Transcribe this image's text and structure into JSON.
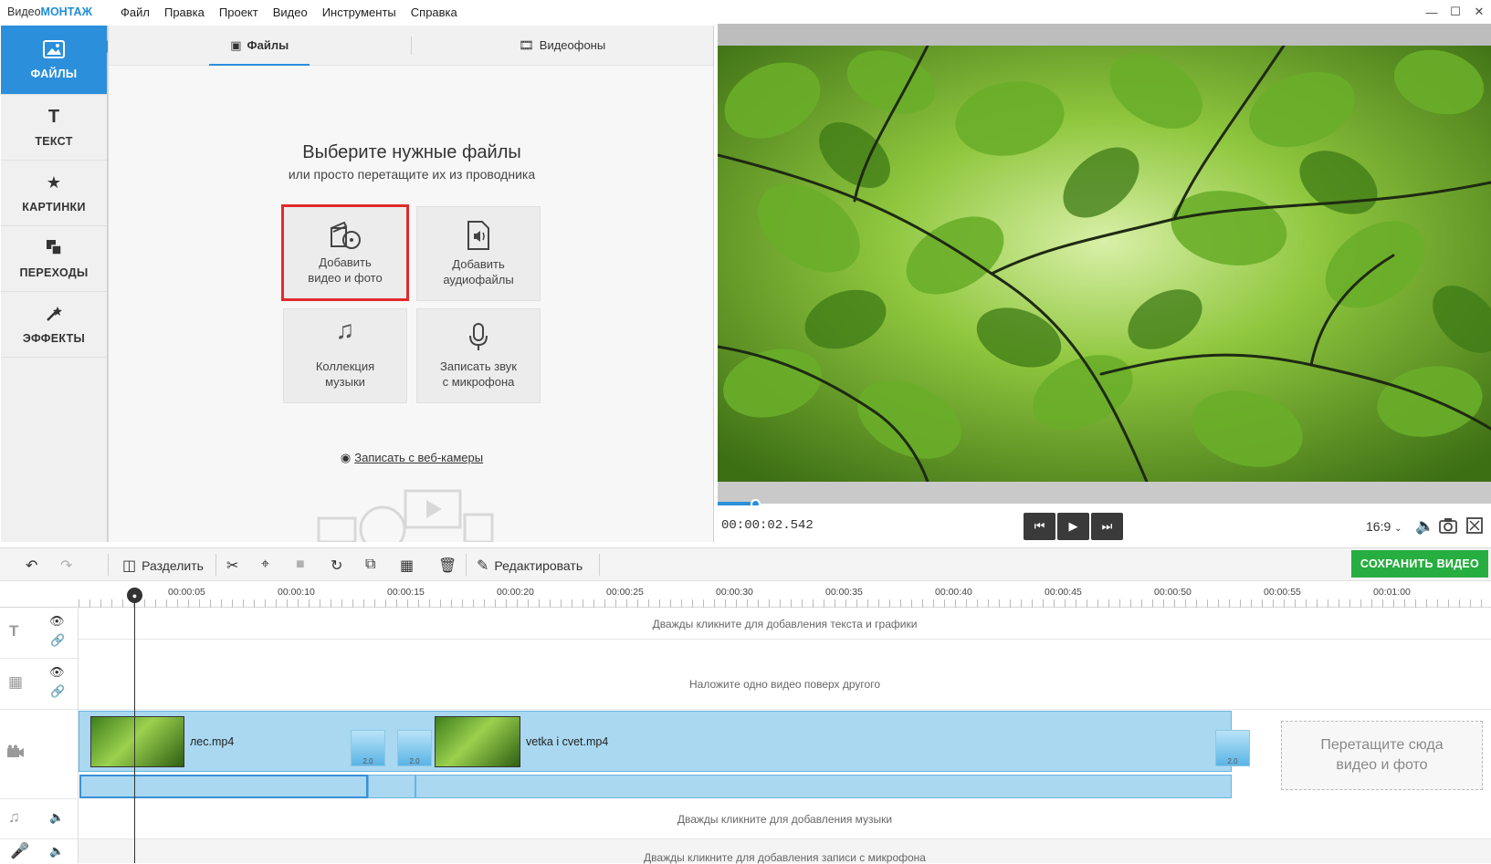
{
  "titlebar": {
    "brand_prefix": "Видео",
    "brand_suffix": "МОНТАЖ",
    "menu": [
      "Файл",
      "Правка",
      "Проект",
      "Видео",
      "Инструменты",
      "Справка"
    ]
  },
  "sidebar": {
    "items": [
      {
        "label": "ФАЙЛЫ",
        "icon": "image-icon",
        "active": true
      },
      {
        "label": "ТЕКСТ",
        "icon": "text-icon"
      },
      {
        "label": "КАРТИНКИ",
        "icon": "star-icon"
      },
      {
        "label": "ПЕРЕХОДЫ",
        "icon": "transitions-icon"
      },
      {
        "label": "ЭФФЕКТЫ",
        "icon": "magic-wand-icon"
      }
    ]
  },
  "files_panel": {
    "tabs": [
      "Файлы",
      "Видеофоны"
    ],
    "heading": "Выберите нужные файлы",
    "subheading": "или просто перетащите их из проводника",
    "tiles": [
      {
        "line1": "Добавить",
        "line2": "видео и фото"
      },
      {
        "line1": "Добавить",
        "line2": "аудиофайлы"
      },
      {
        "line1": "Коллекция",
        "line2": "музыки"
      },
      {
        "line1": "Записать звук",
        "line2": "с микрофона"
      }
    ],
    "webcam_link": "Записать с веб-камеры"
  },
  "preview": {
    "timecode": "00:00:02.542",
    "aspect_ratio": "16:9",
    "progress_fraction": 0.05
  },
  "toolbar": {
    "split_label": "Разделить",
    "edit_label": "Редактировать",
    "save_label": "СОХРАНИТЬ ВИДЕО"
  },
  "ruler": [
    "00:00:05",
    "00:00:10",
    "00:00:15",
    "00:00:20",
    "00:00:25",
    "00:00:30",
    "00:00:35",
    "00:00:40",
    "00:00:45",
    "00:00:50",
    "00:00:55",
    "00:01:00"
  ],
  "timeline": {
    "text_track_hint": "Дважды кликните для добавления текста и графики",
    "overlay_track_hint": "Наложите одно видео поверх другого",
    "clips": [
      {
        "name": "лес.mp4"
      },
      {
        "name": "vetka i cvet.mp4"
      }
    ],
    "transition_duration": "2.0",
    "dropzone": {
      "line1": "Перетащите сюда",
      "line2": "видео и фото"
    },
    "music_track_hint": "Дважды кликните для добавления музыки",
    "mic_track_hint": "Дважды кликните для добавления записи с микрофона"
  },
  "colors": {
    "accent": "#2b8fdb",
    "save": "#27ae40",
    "highlight": "#e12a2a",
    "clip": "#a9d8f0"
  }
}
